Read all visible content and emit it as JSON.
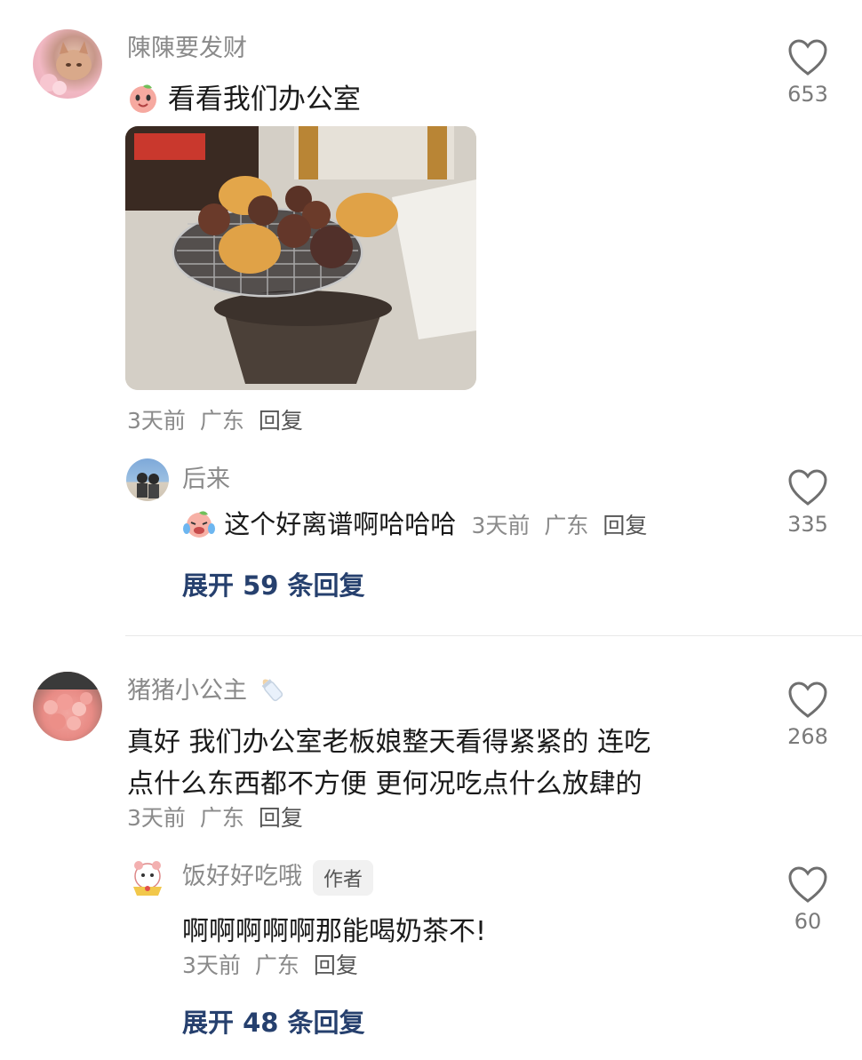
{
  "comments": [
    {
      "username": "陳陳要发财",
      "text": "看看我们办公室",
      "time": "3天前",
      "location": "广东",
      "reply_label": "回复",
      "likes": "653",
      "sub_reply": {
        "username": "后来",
        "text": "这个好离谱啊哈哈哈",
        "time": "3天前",
        "location": "广东",
        "reply_label": "回复",
        "likes": "335"
      },
      "expand_label": "展开 59 条回复"
    },
    {
      "username": "猪猪小公主",
      "text_lines": [
        "真好 我们办公室老板娘整天看得紧紧的 连吃",
        "点什么东西都不方便 更何况吃点什么放肆的"
      ],
      "time": "3天前",
      "location": "广东",
      "reply_label": "回复",
      "likes": "268",
      "sub_reply": {
        "username": "饭好好吃哦",
        "badge": "作者",
        "text": "啊啊啊啊啊那能喝奶茶不!",
        "time": "3天前",
        "location": "广东",
        "reply_label": "回复",
        "likes": "60"
      },
      "expand_label": "展开 48 条回复"
    }
  ],
  "icons": {
    "like": "heart-outline-icon"
  },
  "colors": {
    "expand_link": "#26406e",
    "meta_text": "#8a8a8a"
  }
}
